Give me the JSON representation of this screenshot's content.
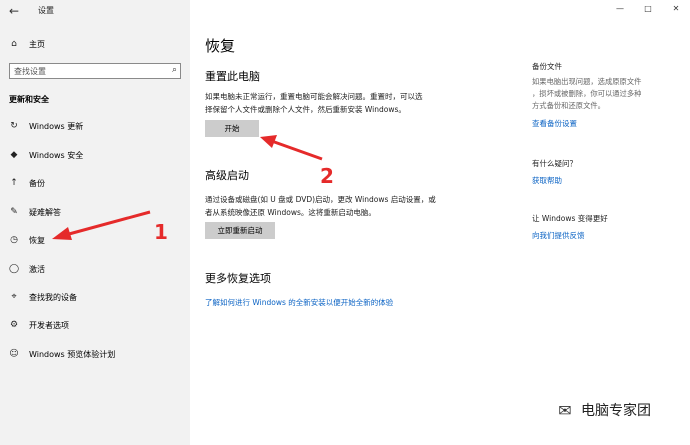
{
  "window": {
    "title": "设置",
    "back_icon": "←",
    "minimize": "—",
    "maximize": "□",
    "close": "✕"
  },
  "sidebar": {
    "home": "主页",
    "search_placeholder": "查找设置",
    "section": "更新和安全",
    "items": [
      {
        "label": "Windows 更新",
        "icon": "↻"
      },
      {
        "label": "Windows 安全",
        "icon": "◆"
      },
      {
        "label": "备份",
        "icon": "↑"
      },
      {
        "label": "疑难解答",
        "icon": "✎"
      },
      {
        "label": "恢复",
        "icon": "◷"
      },
      {
        "label": "激活",
        "icon": "◯"
      },
      {
        "label": "查找我的设备",
        "icon": "⌖"
      },
      {
        "label": "开发者选项",
        "icon": "⚙"
      },
      {
        "label": "Windows 预览体验计划",
        "icon": "☺"
      }
    ],
    "annotation": "1"
  },
  "main": {
    "title": "恢复",
    "reset": {
      "heading": "重置此电脑",
      "description_line1": "如果电脑未正常运行，重置电脑可能会解决问题。重置时，可以选",
      "description_line2": "择保留个人文件或删除个人文件，然后重新安装 Windows。",
      "button": "开始",
      "annotation": "2"
    },
    "advanced": {
      "heading": "高级启动",
      "description_line1": "通过设备或磁盘(如 U 盘或 DVD)启动，更改 Windows 启动设置，或",
      "description_line2": "者从系统映像还原 Windows。这将重新启动电脑。",
      "button": "立即重新启动"
    },
    "more": {
      "heading": "更多恢复选项",
      "link": "了解如何进行 Windows 的全新安装以便开始全新的体验"
    }
  },
  "right": {
    "backup_title": "备份文件",
    "backup_text_line1": "如果电脑出现问题，选成原原文件",
    "backup_text_line2": "，损坏或被删除，你可以通过多种",
    "backup_text_line3": "方式备份和还原文件。",
    "backup_link": "查看备份设置",
    "question_title": "有什么疑问？",
    "help_link": "获取帮助",
    "better_title": "让 Windows 变得更好",
    "feedback_link": "向我们提供反馈"
  },
  "watermark": {
    "text": "电脑专家团",
    "icon": "✉"
  }
}
